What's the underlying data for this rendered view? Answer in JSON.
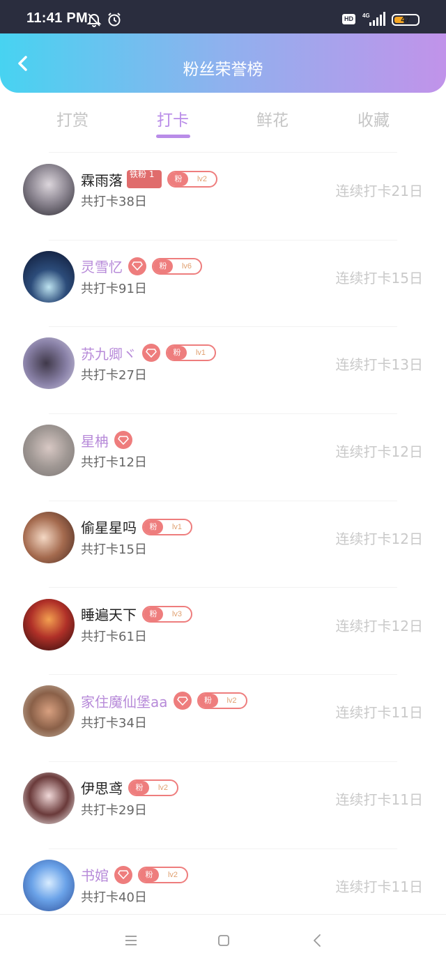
{
  "status_bar": {
    "time": "11:41 PM",
    "hd": "HD",
    "network": "4G",
    "battery": "47",
    "battery_level": 0.47
  },
  "header": {
    "title": "粉丝荣誉榜",
    "back_icon": "chevron-left-icon"
  },
  "tabs": [
    {
      "label": "打赏",
      "active": false
    },
    {
      "label": "打卡",
      "active": true
    },
    {
      "label": "鲜花",
      "active": false
    },
    {
      "label": "收藏",
      "active": false
    }
  ],
  "accent_color": "#b98ce8",
  "badge_color": "#ee7d7d",
  "fans": [
    {
      "name": "霖雨落",
      "vip": false,
      "diamond": false,
      "iron_badge": "铁粉 1",
      "fan_label": "粉",
      "level": "lv2",
      "total": "共打卡38日",
      "streak": "连续打卡21日"
    },
    {
      "name": "灵雪忆",
      "vip": true,
      "diamond": true,
      "iron_badge": "",
      "fan_label": "粉",
      "level": "lv6",
      "total": "共打卡91日",
      "streak": "连续打卡15日"
    },
    {
      "name": "苏九卿ヾ",
      "vip": true,
      "diamond": true,
      "iron_badge": "",
      "fan_label": "粉",
      "level": "lv1",
      "total": "共打卡27日",
      "streak": "连续打卡13日"
    },
    {
      "name": "星柟",
      "vip": true,
      "diamond": true,
      "iron_badge": "",
      "fan_label": "",
      "level": "",
      "total": "共打卡12日",
      "streak": "连续打卡12日"
    },
    {
      "name": "偷星星吗",
      "vip": false,
      "diamond": false,
      "iron_badge": "",
      "fan_label": "粉",
      "level": "lv1",
      "total": "共打卡15日",
      "streak": "连续打卡12日"
    },
    {
      "name": "睡遍天下",
      "vip": false,
      "diamond": false,
      "iron_badge": "",
      "fan_label": "粉",
      "level": "lv3",
      "total": "共打卡61日",
      "streak": "连续打卡12日"
    },
    {
      "name": "家住魔仙堡aa",
      "vip": true,
      "diamond": true,
      "iron_badge": "",
      "fan_label": "粉",
      "level": "lv2",
      "total": "共打卡34日",
      "streak": "连续打卡11日"
    },
    {
      "name": "伊思鸢",
      "vip": false,
      "diamond": false,
      "iron_badge": "",
      "fan_label": "粉",
      "level": "lv2",
      "total": "共打卡29日",
      "streak": "连续打卡11日"
    },
    {
      "name": "书婠",
      "vip": true,
      "diamond": true,
      "iron_badge": "",
      "fan_label": "粉",
      "level": "lv2",
      "total": "共打卡40日",
      "streak": "连续打卡11日"
    }
  ],
  "nav_bar": {
    "menu_icon": "menu-icon",
    "home_icon": "home-square-icon",
    "back_icon": "back-triangle-icon"
  }
}
